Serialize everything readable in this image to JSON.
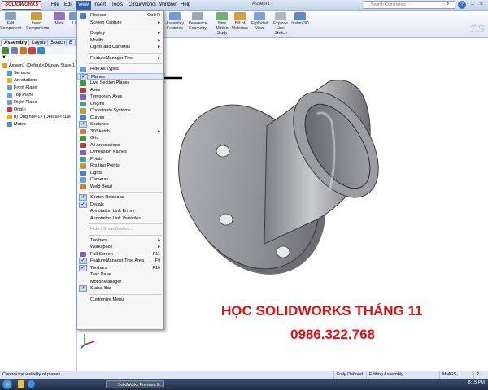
{
  "app": {
    "logo": "SOLIDWORKS",
    "doc_title": "Assem1 *",
    "menu": [
      "File",
      "Edit",
      "View",
      "Insert",
      "Tools",
      "CircuitWorks",
      "Window",
      "Help"
    ],
    "active_menu": "View",
    "search_placeholder": "Search Commands"
  },
  "ribbon": {
    "buttons": [
      {
        "label": "Edit Component",
        "icon": "edit-component-icon"
      },
      {
        "label": "Insert Components",
        "icon": "insert-components-icon"
      },
      {
        "label": "Mate",
        "icon": "mate-icon"
      },
      {
        "label": "Li",
        "icon": "linear-pattern-icon"
      },
      {
        "label": "Assembly Features",
        "icon": "assembly-features-icon"
      },
      {
        "label": "Reference Geometry",
        "icon": "reference-geometry-icon"
      },
      {
        "label": "New Motion Study",
        "icon": "motion-study-icon"
      },
      {
        "label": "Bill of Materials",
        "icon": "bom-icon"
      },
      {
        "label": "Exploded View",
        "icon": "exploded-view-icon"
      },
      {
        "label": "Explode Line Sketch",
        "icon": "explode-line-icon"
      },
      {
        "label": "Instant3D",
        "icon": "instant3d-icon"
      }
    ]
  },
  "feature_manager": {
    "tabs": [
      "Assembly",
      "Layout",
      "Sketch",
      "E"
    ],
    "filter_symbol": "▼",
    "tree": [
      {
        "label": "Assem1  (Default<Display State-1",
        "indent": 0,
        "color": "#d8a020"
      },
      {
        "label": "Sensors",
        "indent": 1,
        "color": "#4aa0d8"
      },
      {
        "label": "Annotations",
        "indent": 1,
        "color": "#e0b030"
      },
      {
        "label": "Front Plane",
        "indent": 1,
        "color": "#6fa0d0"
      },
      {
        "label": "Top Plane",
        "indent": 1,
        "color": "#6fa0d0"
      },
      {
        "label": "Right Plane",
        "indent": 1,
        "color": "#6fa0d0"
      },
      {
        "label": "Origin",
        "indent": 1,
        "color": "#c04040"
      },
      {
        "label": "(f) Ống nối<1> (Default<<De",
        "indent": 1,
        "color": "#e0b030"
      },
      {
        "label": "Mates",
        "indent": 1,
        "color": "#5090c0"
      }
    ]
  },
  "view_menu": {
    "items": [
      {
        "label": "Redraw",
        "shortcut": "Ctrl+R",
        "icon": "redraw-icon"
      },
      {
        "label": "Screen Capture",
        "arrow": "▸"
      },
      {
        "sep": true
      },
      {
        "label": "Display",
        "arrow": "▸"
      },
      {
        "label": "Modify",
        "arrow": "▸"
      },
      {
        "label": "Lights and Cameras",
        "arrow": "▸"
      },
      {
        "sep": true
      },
      {
        "label": "FeatureManager Tree",
        "arrow": "▸"
      },
      {
        "sep": true
      },
      {
        "label": "Hide All Types",
        "icon": "hide-all-icon"
      },
      {
        "label": "Planes",
        "icon": "planes-icon",
        "highlight": true,
        "checked": true
      },
      {
        "label": "Live Section Planes",
        "icon": "live-section-icon"
      },
      {
        "label": "Axes",
        "icon": "axes-icon"
      },
      {
        "label": "Temporary Axes",
        "icon": "temp-axes-icon"
      },
      {
        "label": "Origins",
        "icon": "origins-icon"
      },
      {
        "label": "Coordinate Systems",
        "icon": "coord-icon"
      },
      {
        "label": "Curves",
        "icon": "curves-icon"
      },
      {
        "label": "Sketches",
        "icon": "sketches-icon",
        "checked": true
      },
      {
        "label": "3DSketch",
        "arrow": "▸",
        "icon": "3dsketch-icon"
      },
      {
        "label": "Grid",
        "icon": "grid-icon"
      },
      {
        "label": "All Annotations",
        "icon": "annotations-icon"
      },
      {
        "label": "Dimension Names",
        "icon": "dimension-icon"
      },
      {
        "label": "Points",
        "icon": "points-icon"
      },
      {
        "label": "Routing Points",
        "icon": "routing-icon"
      },
      {
        "label": "Lights",
        "icon": "lights-icon"
      },
      {
        "label": "Cameras",
        "icon": "cameras-icon"
      },
      {
        "label": "Weld Bead",
        "icon": "weld-icon"
      },
      {
        "sep": true
      },
      {
        "label": "Sketch Relations",
        "icon": "relations-icon",
        "checked": true
      },
      {
        "label": "Decals",
        "icon": "decals-icon",
        "checked": true
      },
      {
        "label": "Annotation Link Errors"
      },
      {
        "label": "Annotation Link Variables"
      },
      {
        "sep": true
      },
      {
        "label": "Hide / Show Bodies...",
        "disabled": true
      },
      {
        "sep": true
      },
      {
        "label": "Toolbars",
        "arrow": "▸"
      },
      {
        "label": "Workspace",
        "arrow": "▸"
      },
      {
        "label": "Full Screen",
        "shortcut": "F11",
        "icon": "fullscreen-icon"
      },
      {
        "label": "FeatureManager Tree Area",
        "shortcut": "F9",
        "checked": true
      },
      {
        "label": "Toolbars",
        "shortcut": "F10",
        "checked": true
      },
      {
        "label": "Task Pane"
      },
      {
        "label": "MotionManager"
      },
      {
        "label": "Status Bar",
        "checked": true
      },
      {
        "sep": true
      },
      {
        "label": "Customize Menu"
      }
    ]
  },
  "overlay": {
    "title": "HỌC SOLIDWORKS THÁNG 11",
    "phone": "0986.322.768",
    "arrow": "←"
  },
  "status_bar": {
    "message": "Control the visibility of planes.",
    "state": "Fully Defined",
    "mode": "Editing Assembly",
    "units": "MMGS",
    "help": "?"
  },
  "taskbar": {
    "task": "SolidWorks Premium 2...",
    "clock": "8:15 PM"
  },
  "colors": {
    "accent": "#2f5ea8",
    "overlay_red": "#e01010",
    "model_gray": "#8d8f94"
  }
}
